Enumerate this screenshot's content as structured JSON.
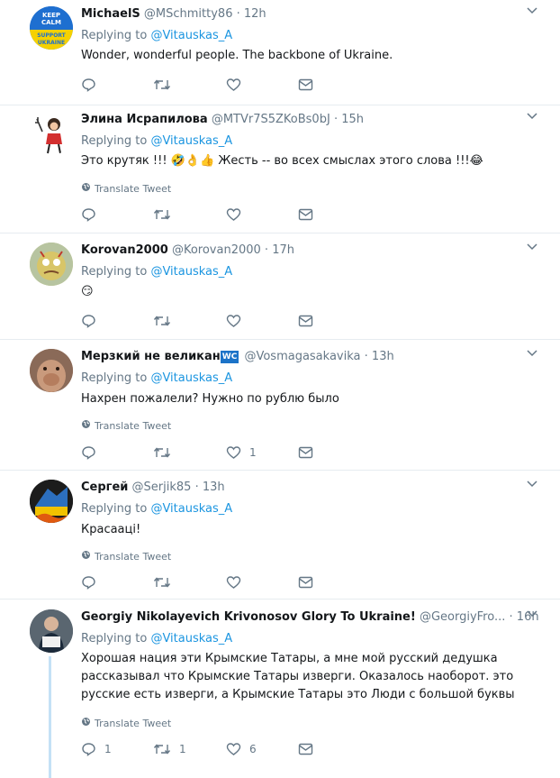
{
  "tweets": [
    {
      "name": "MichaelS",
      "handle": "@MSchmitty86",
      "time": "12h",
      "replying_prefix": "Replying to",
      "replying_to": "@Vitauskas_A",
      "text": "Wonder, wonderful people. The backbone of Ukraine.",
      "avatar_text": "KEEP CALM AND SUPPORT UKRAINE",
      "translate": "",
      "reply_count": "",
      "retweet_count": "",
      "like_count": ""
    },
    {
      "name": "Элина Исрапилова",
      "handle": "@MTVr7S5ZKoBs0bJ",
      "time": "15h",
      "replying_prefix": "Replying to",
      "replying_to": "@Vitauskas_A",
      "text": "Это крутяк !!! 🤣👌👍 Жесть -- во всех смыслах этого слова !!!😂",
      "translate": "Translate Tweet",
      "reply_count": "",
      "retweet_count": "",
      "like_count": ""
    },
    {
      "name": "Korovan2000",
      "handle": "@Korovan2000",
      "time": "17h",
      "replying_prefix": "Replying to",
      "replying_to": "@Vitauskas_A",
      "text": "😏",
      "translate": "",
      "reply_count": "",
      "retweet_count": "",
      "like_count": ""
    },
    {
      "name": "Мерзкий не великан",
      "badge": "WC",
      "handle": "@Vosmagasakavika",
      "time": "13h",
      "replying_prefix": "Replying to",
      "replying_to": "@Vitauskas_A",
      "text": "Нахрен пожалели? Нужно по рублю было",
      "translate": "Translate Tweet",
      "reply_count": "",
      "retweet_count": "",
      "like_count": "1"
    },
    {
      "name": "Сергей",
      "handle": "@Serjik85",
      "time": "13h",
      "replying_prefix": "Replying to",
      "replying_to": "@Vitauskas_A",
      "text": "Красаацi!",
      "translate": "Translate Tweet",
      "reply_count": "",
      "retweet_count": "",
      "like_count": ""
    },
    {
      "name": "Georgiy Nikolayevich Krivonosov Glory To Ukraine!",
      "handle": "@GeorgiyFro...",
      "time": "16h",
      "replying_prefix": "Replying to",
      "replying_to": "@Vitauskas_A",
      "text": "Хорошая нация эти Крымские Татары, а мне мой русский дедушка рассказывал что Крымские Татары изверги. Оказалось наоборот. это русские есть изверги, а Крымские Татары это Люди с большой буквы",
      "translate": "Translate Tweet",
      "reply_count": "1",
      "retweet_count": "1",
      "like_count": "6"
    }
  ],
  "dot": "·",
  "caret": "⌄",
  "colors": {
    "link": "#1b95e0",
    "muted": "#657786",
    "border": "#e6ecf0"
  }
}
